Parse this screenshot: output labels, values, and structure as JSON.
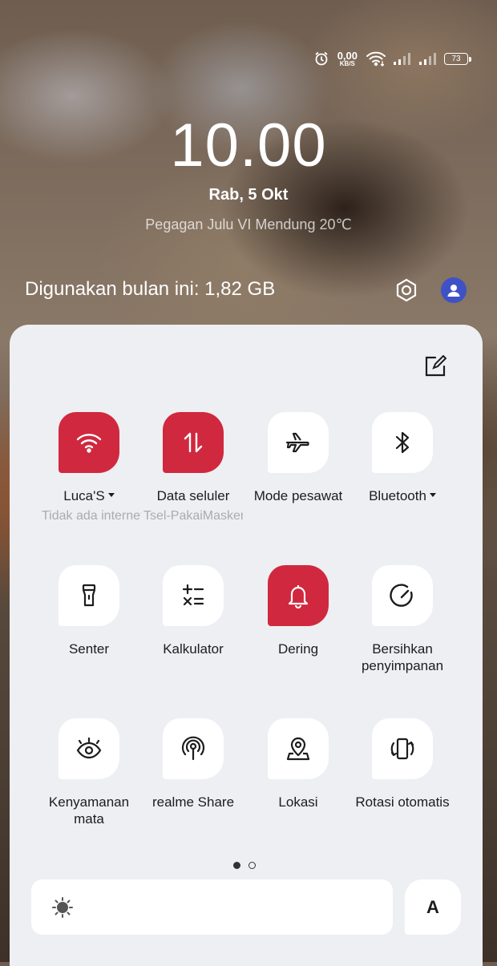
{
  "status_bar": {
    "speed_value": "0,00",
    "speed_unit": "KB/S",
    "battery": "73",
    "icons": [
      "alarm-icon",
      "wifi-icon",
      "signal-icon",
      "signal-icon",
      "battery-icon"
    ]
  },
  "lockscreen": {
    "time": "10.00",
    "date": "Rab, 5 Okt",
    "weather": "Pegagan Julu VI Mendung 20℃"
  },
  "usage_text": "Digunakan bulan ini: 1,82 GB",
  "accent_color": "#d0283e",
  "tiles": [
    {
      "label": "Luca'S",
      "sub": "Tidak ada internet",
      "icon": "wifi-icon",
      "active": true,
      "dropdown": true
    },
    {
      "label": "Data seluler",
      "sub": "Tsel-PakaiMasker",
      "icon": "mobile-data-icon",
      "active": true
    },
    {
      "label": "Mode pesawat",
      "icon": "airplane-icon",
      "active": false
    },
    {
      "label": "Bluetooth",
      "icon": "bluetooth-icon",
      "active": false,
      "dropdown": true
    },
    {
      "label": "Senter",
      "icon": "flashlight-icon",
      "active": false
    },
    {
      "label": "Kalkulator",
      "icon": "calculator-icon",
      "active": false
    },
    {
      "label": "Dering",
      "icon": "bell-icon",
      "active": true
    },
    {
      "label": "Bersihkan penyimpanan",
      "icon": "gauge-icon",
      "active": false
    },
    {
      "label": "Kenyamanan mata",
      "icon": "eye-icon",
      "active": false
    },
    {
      "label": "realme Share",
      "icon": "share-signal-icon",
      "active": false
    },
    {
      "label": "Lokasi",
      "icon": "location-icon",
      "active": false
    },
    {
      "label": "Rotasi otomatis",
      "icon": "rotate-icon",
      "active": false
    }
  ],
  "pager": {
    "pages": 2,
    "current": 1
  },
  "brightness": {
    "icon": "sun-icon",
    "auto_label": "A"
  }
}
